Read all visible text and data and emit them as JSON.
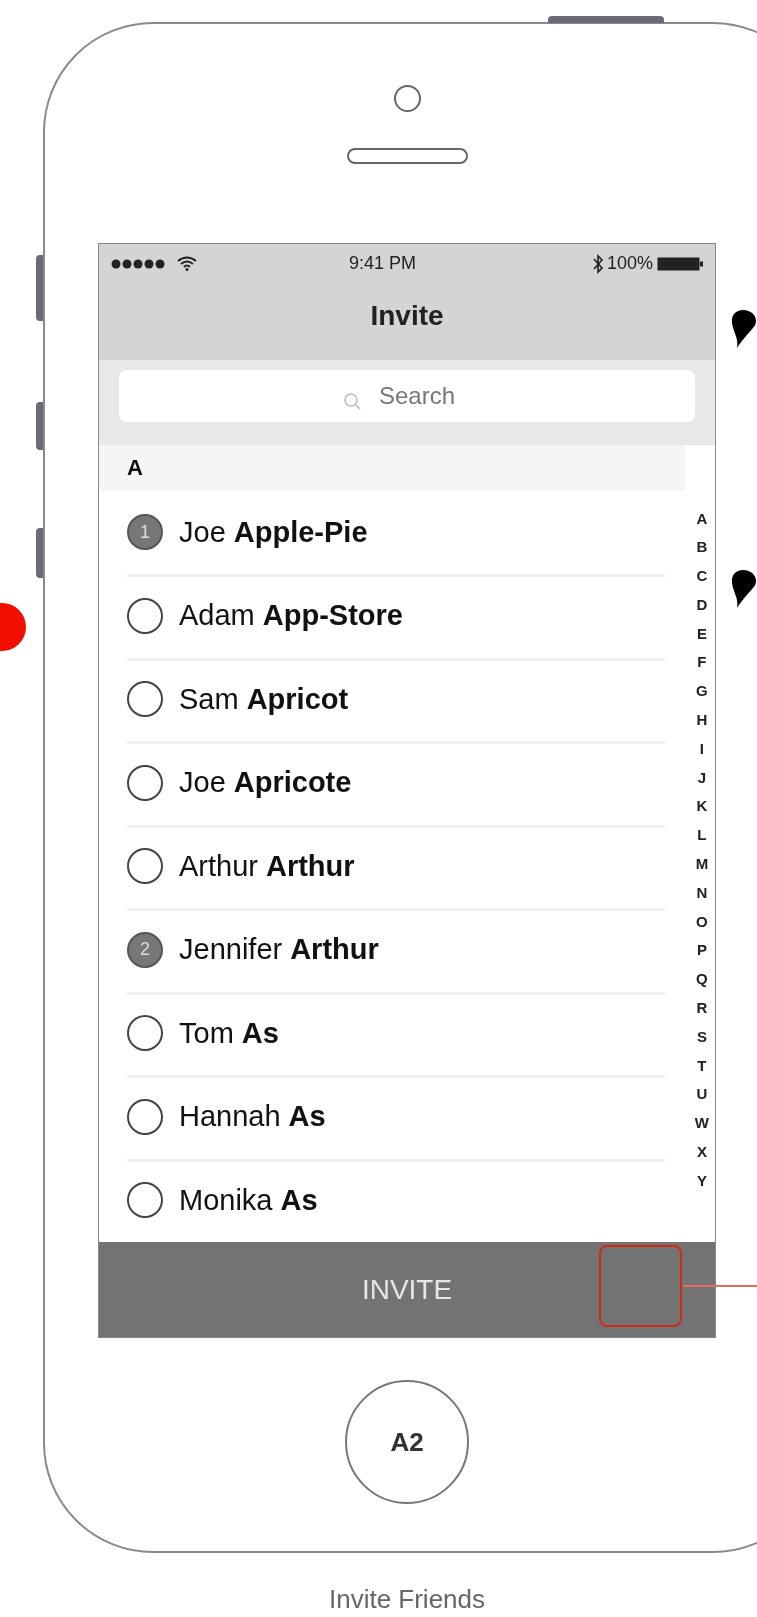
{
  "status_bar": {
    "time": "9:41 PM",
    "battery": "100%"
  },
  "nav": {
    "title": "Invite"
  },
  "search": {
    "placeholder": "Search"
  },
  "section": {
    "header": "A"
  },
  "contacts": [
    {
      "first": "Joe",
      "last": "Apple-Pie",
      "selected": true,
      "badge": "1"
    },
    {
      "first": "Adam",
      "last": "App-Store",
      "selected": false
    },
    {
      "first": "Sam",
      "last": "Apricot",
      "selected": false
    },
    {
      "first": "Joe",
      "last": "Apricote",
      "selected": false
    },
    {
      "first": "Arthur",
      "last": "Arthur",
      "selected": false
    },
    {
      "first": "Jennifer",
      "last": "Arthur",
      "selected": true,
      "badge": "2"
    },
    {
      "first": "Tom",
      "last": "As",
      "selected": false
    },
    {
      "first": "Hannah",
      "last": "As",
      "selected": false
    },
    {
      "first": "Monika",
      "last": "As",
      "selected": false
    }
  ],
  "index": [
    "A",
    "B",
    "C",
    "D",
    "E",
    "F",
    "G",
    "H",
    "I",
    "J",
    "K",
    "L",
    "M",
    "N",
    "O",
    "P",
    "Q",
    "R",
    "S",
    "T",
    "U",
    "W",
    "X",
    "Y"
  ],
  "invite_button": {
    "label": "INVITE"
  },
  "home_button": {
    "label": "A2"
  },
  "caption": "Invite Friends"
}
